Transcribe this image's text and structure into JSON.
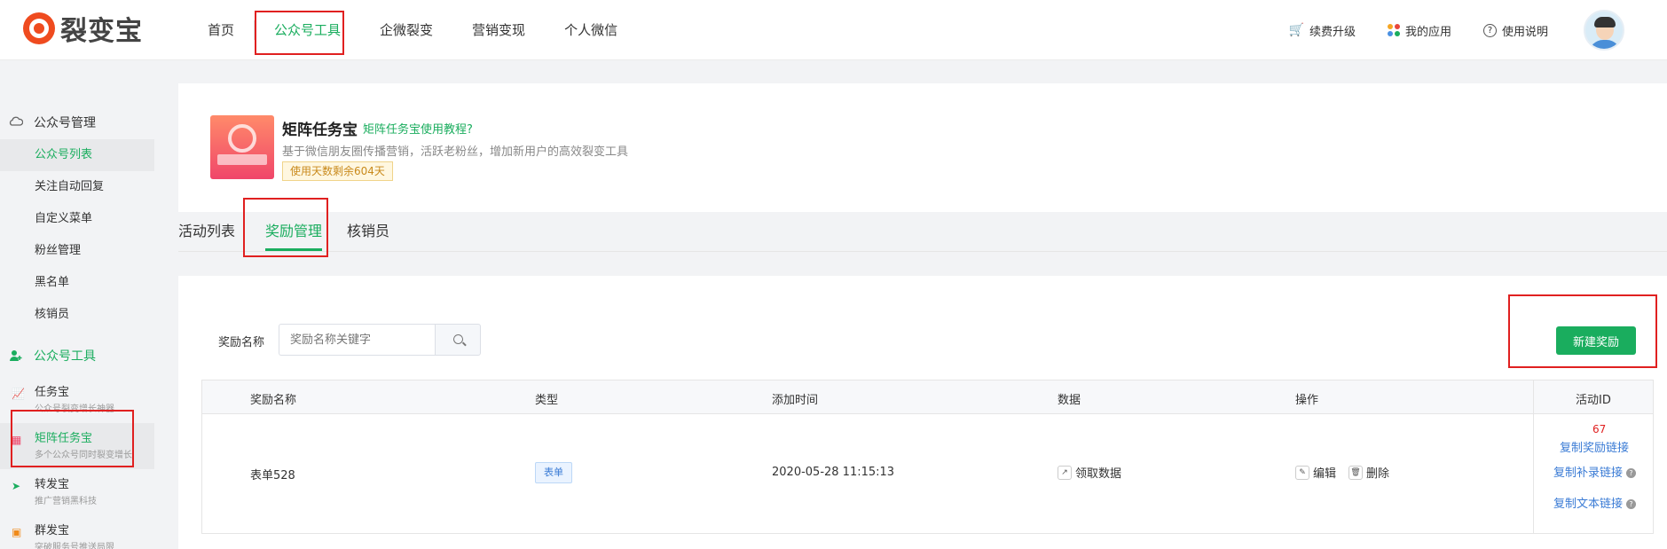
{
  "brand": {
    "name": "裂变宝"
  },
  "nav": {
    "items": [
      "首页",
      "公众号工具",
      "企微裂变",
      "营销变现",
      "个人微信"
    ]
  },
  "topbar": {
    "renew": "续费升级",
    "my_apps": "我的应用",
    "help": "使用说明"
  },
  "sidebar": {
    "group1": "公众号管理",
    "group1_items": [
      "公众号列表",
      "关注自动回复",
      "自定义菜单",
      "粉丝管理",
      "黑名单",
      "核销员"
    ],
    "group2": "公众号工具",
    "tools": [
      {
        "title": "任务宝",
        "sub": "公众号裂变增长神器"
      },
      {
        "title": "矩阵任务宝",
        "sub": "多个公众号同时裂变增长"
      },
      {
        "title": "转发宝",
        "sub": "推广营销黑科技"
      },
      {
        "title": "群发宝",
        "sub": "突破服务号推送局限"
      }
    ]
  },
  "app": {
    "title": "矩阵任务宝",
    "tutorial_link": "矩阵任务宝使用教程?",
    "description": "基于微信朋友圈传播营销，活跃老粉丝，增加新用户的高效裂变工具",
    "days_left": "使用天数剩余604天"
  },
  "tabs": [
    "活动列表",
    "奖励管理",
    "核销员"
  ],
  "filter": {
    "label": "奖励名称",
    "placeholder": "奖励名称关键字"
  },
  "new_button": "新建奖励",
  "table": {
    "headers": [
      "奖励名称",
      "类型",
      "添加时间",
      "数据",
      "操作",
      "活动ID"
    ],
    "row": {
      "name": "表单528",
      "type": "表单",
      "time": "2020-05-28 11:15:13",
      "data": "领取数据",
      "edit": "编辑",
      "delete": "删除",
      "activity_id": "67",
      "link1": "复制奖励链接",
      "link2": "复制补录链接",
      "link3": "复制文本链接"
    }
  },
  "colors": {
    "accent": "#1aad5e",
    "highlight_box": "#e02020",
    "link": "#3a7bd5"
  }
}
